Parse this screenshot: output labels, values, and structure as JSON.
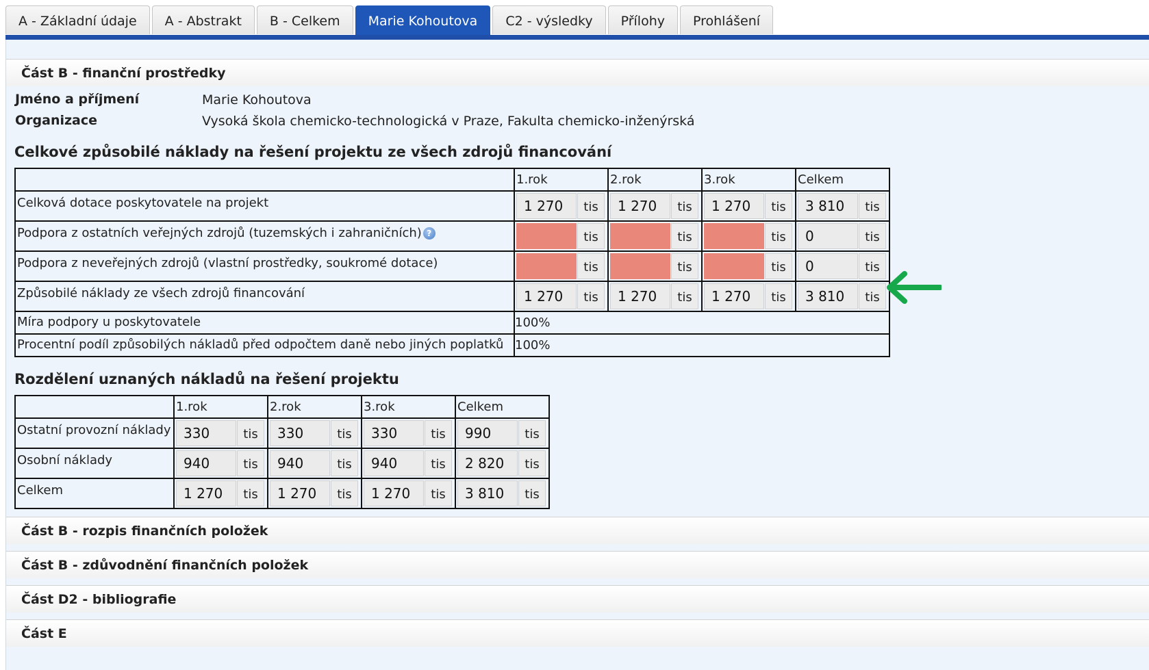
{
  "tabs": [
    "A - Základní údaje",
    "A - Abstrakt",
    "B - Celkem",
    "Marie Kohoutova",
    "C2 - výsledky",
    "Přílohy",
    "Prohlášení"
  ],
  "section_main": "Část B - finanční prostředky",
  "person": {
    "name_label": "Jméno a příjmení",
    "name_value": "Marie Kohoutova",
    "org_label": "Organizace",
    "org_value": "Vysoká škola chemicko-technologická v Praze, Fakulta chemicko-inženýrská"
  },
  "table1": {
    "title": "Celkové způsobilé náklady na řešení projektu ze všech zdrojů financování",
    "headers": [
      "1.rok",
      "2.rok",
      "3.rok",
      "Celkem"
    ],
    "unit": "tis",
    "rows": [
      {
        "label": "Celková dotace poskytovatele na projekt",
        "values": [
          "1 270",
          "1 270",
          "1 270",
          "3 810"
        ]
      },
      {
        "label": "Podpora z ostatních veřejných zdrojů (tuzemských i zahraničních)",
        "values": [
          "",
          "",
          "",
          "0"
        ]
      },
      {
        "label": "Podpora z neveřejných zdrojů (vlastní prostředky, soukromé dotace)",
        "values": [
          "",
          "",
          "",
          "0"
        ]
      },
      {
        "label": "Způsobilé náklady ze všech zdrojů financování",
        "values": [
          "1 270",
          "1 270",
          "1 270",
          "3 810"
        ]
      }
    ],
    "pct_rows": [
      {
        "label": "Míra podpory u poskytovatele",
        "value": "100%"
      },
      {
        "label": "Procentní podíl způsobilých nákladů před odpočtem daně nebo jiných poplatků",
        "value": "100%"
      }
    ]
  },
  "table2": {
    "title": "Rozdělení uznaných nákladů na řešení projektu",
    "headers": [
      "1.rok",
      "2.rok",
      "3.rok",
      "Celkem"
    ],
    "unit": "tis",
    "rows": [
      {
        "label": "Ostatní provozní náklady",
        "values": [
          "330",
          "330",
          "330",
          "990"
        ]
      },
      {
        "label": "Osobní náklady",
        "values": [
          "940",
          "940",
          "940",
          "2 820"
        ]
      },
      {
        "label": "Celkem",
        "values": [
          "1 270",
          "1 270",
          "1 270",
          "3 810"
        ]
      }
    ]
  },
  "sections": [
    "Část B - rozpis finančních položek",
    "Část B - zdůvodnění finančních položek",
    "Část D2 - bibliografie",
    "Část E"
  ],
  "colors": {
    "active_tab": "#1f57b8",
    "missing_field": "#e8877a",
    "arrow": "#17a84b"
  }
}
